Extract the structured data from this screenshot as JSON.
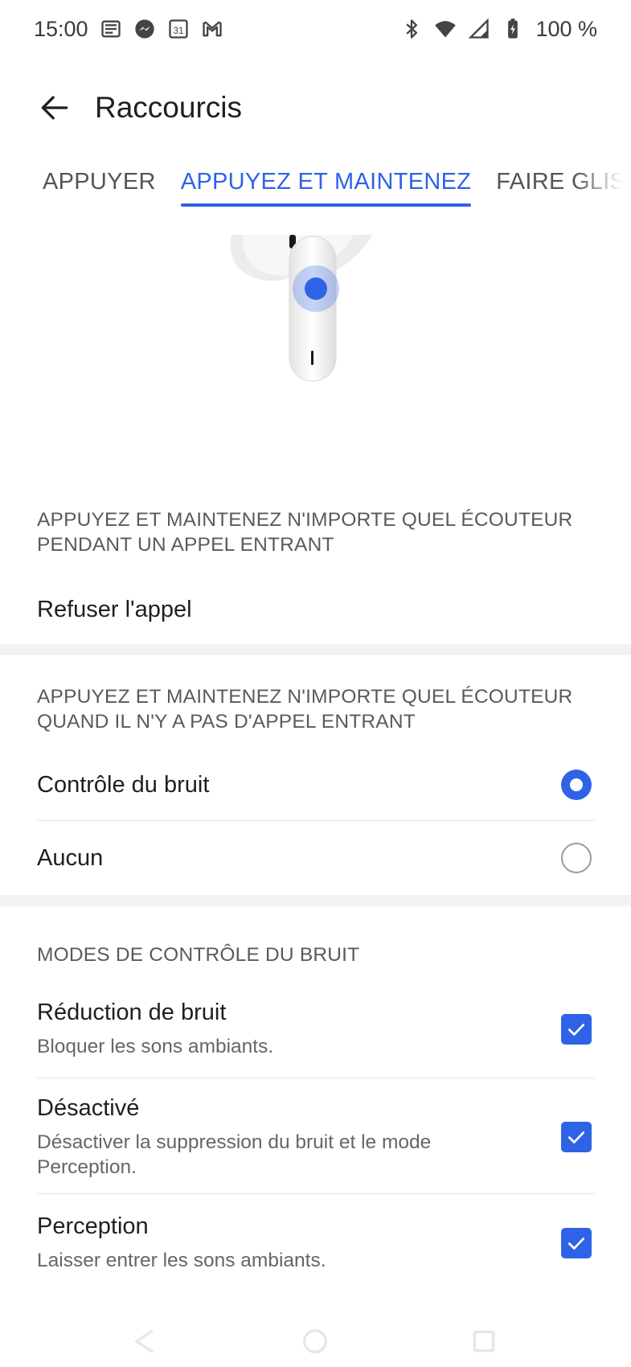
{
  "status_bar": {
    "time": "15:00",
    "battery": "100 %",
    "left_icons": [
      "news-icon",
      "messenger-icon",
      "calendar-icon",
      "gmail-icon"
    ],
    "calendar_day": "31",
    "right_icons": [
      "bluetooth-icon",
      "wifi-icon",
      "signal-icon",
      "battery-icon"
    ]
  },
  "app_bar": {
    "title": "Raccourcis",
    "back_icon": "arrow-back-icon"
  },
  "tabs": [
    {
      "label": "APPUYER",
      "active": false
    },
    {
      "label": "APPUYEZ ET MAINTENEZ",
      "active": true
    },
    {
      "label": "FAIRE GLISSER",
      "active": false
    }
  ],
  "colors": {
    "accent": "#2f63e6",
    "section_header": "#5a5a5a",
    "band": "#f2f2f2"
  },
  "incoming_call": {
    "header": "APPUYEZ ET MAINTENEZ N'IMPORTE QUEL ÉCOUTEUR PENDANT UN APPEL ENTRANT",
    "action": "Refuser l'appel"
  },
  "no_call": {
    "header": "APPUYEZ ET MAINTENEZ N'IMPORTE QUEL ÉCOUTEUR QUAND IL N'Y A PAS D'APPEL ENTRANT",
    "options": [
      {
        "label": "Contrôle du bruit",
        "selected": true
      },
      {
        "label": "Aucun",
        "selected": false
      }
    ]
  },
  "noise_modes": {
    "header": "MODES DE CONTRÔLE DU BRUIT",
    "items": [
      {
        "title": "Réduction de bruit",
        "subtitle": "Bloquer les sons ambiants.",
        "checked": true
      },
      {
        "title": "Désactivé",
        "subtitle": "Désactiver la suppression du bruit et le mode Perception.",
        "checked": true
      },
      {
        "title": "Perception",
        "subtitle": "Laisser entrer les sons ambiants.",
        "checked": true
      }
    ]
  },
  "nav_bar": [
    "back-nav-icon",
    "home-nav-icon",
    "recents-nav-icon"
  ]
}
